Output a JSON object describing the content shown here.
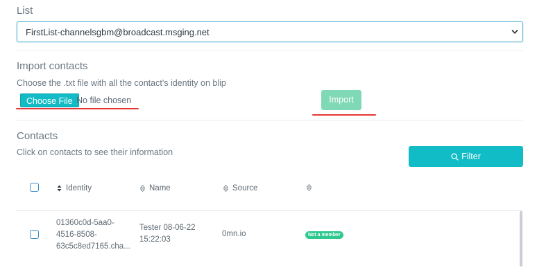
{
  "list": {
    "label": "List",
    "selected": "FirstList-channelsgbm@broadcast.msging.net"
  },
  "import": {
    "title": "Import contacts",
    "instruction": "Choose the .txt file with all the contact's identity on blip",
    "choose_file_label": "Choose File",
    "file_status": "No file chosen",
    "import_label": "Import"
  },
  "contacts": {
    "title": "Contacts",
    "subtitle": "Click on contacts to see their information",
    "filter_label": "Filter",
    "columns": [
      "Identity",
      "Name",
      "Source"
    ],
    "rows": [
      {
        "identity_lines": [
          "01360c0d-5aa0-",
          "4516-8508-",
          "63c5c8ed7165.cha..."
        ],
        "name_lines": [
          "Tester 08-06-22",
          "15:22:03"
        ],
        "source": "0mn.io",
        "status": "Not a member"
      }
    ]
  },
  "colors": {
    "primary": "#12bcc6",
    "import_disabled": "#7fd9b7",
    "status_green": "#2fc98f",
    "annotation_red": "#e53535"
  }
}
